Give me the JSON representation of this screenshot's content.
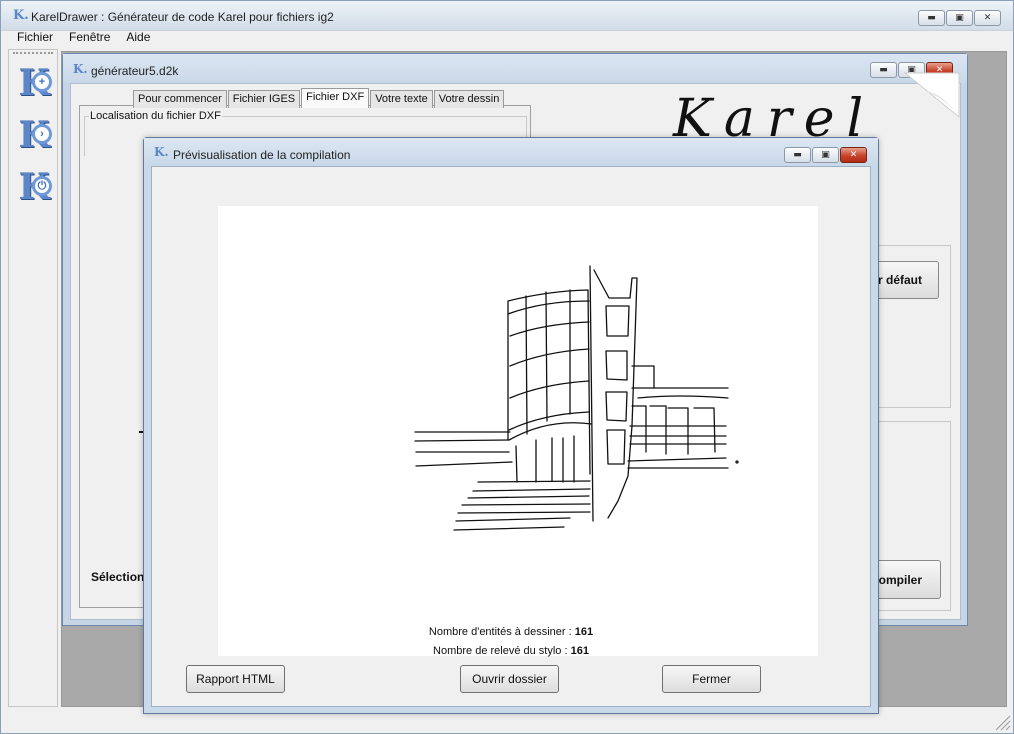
{
  "app": {
    "title": "KarelDrawer : Générateur de code Karel pour fichiers ig2",
    "menu": [
      "Fichier",
      "Fenêtre",
      "Aide"
    ]
  },
  "child_window": {
    "title": "générateur5.d2k",
    "tabs": [
      "Pour commencer",
      "Fichier IGES",
      "Fichier DXF",
      "Votre texte",
      "Votre dessin"
    ],
    "active_tab": "Fichier DXF",
    "group_label": "Localisation du fichier DXF",
    "logo_text": "Karel",
    "button_default": "r défaut",
    "button_compile": "ompiler",
    "selection_label": "Sélection"
  },
  "dialog": {
    "title": "Prévisualisation de la compilation",
    "stat1_label": "Nombre d'entités à dessiner :",
    "stat1_value": "161",
    "stat2_label": "Nombre de relevé du stylo :",
    "stat2_value": "161",
    "btn_report": "Rapport HTML",
    "btn_open": "Ouvrir dossier",
    "btn_close": "Fermer"
  },
  "window_buttons": {
    "minimize": "▬",
    "maximize": "▣",
    "close": "✕"
  },
  "colors": {
    "close_button": "#c8432b",
    "titlebar": "#dfe7ef",
    "mdi_bg": "#a9a9a9",
    "logo_blue": "#5c86c8"
  }
}
